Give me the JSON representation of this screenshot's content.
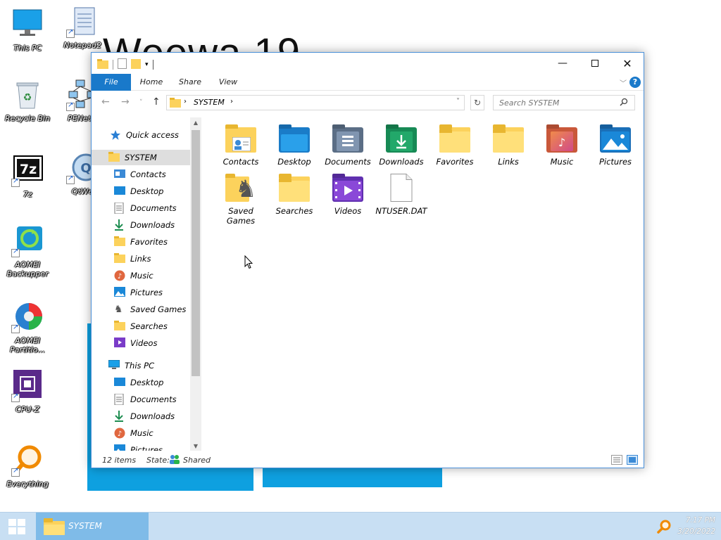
{
  "desktop": {
    "wallpaper_text": "Weewa 19",
    "icons": [
      {
        "label": "This PC"
      },
      {
        "label": "Notepad2"
      },
      {
        "label": "Recycle Bin"
      },
      {
        "label": "PENetw"
      },
      {
        "label": "7z"
      },
      {
        "label": "QtWe"
      },
      {
        "label": "AOMEI Backupper"
      },
      {
        "label": "AOMEI Partitio..."
      },
      {
        "label": "CPU-Z"
      },
      {
        "label": "Everything"
      }
    ]
  },
  "window": {
    "ribbon_tabs": {
      "file": "File",
      "home": "Home",
      "share": "Share",
      "view": "View"
    },
    "help_label": "?",
    "address": {
      "crumb": "SYSTEM"
    },
    "search": {
      "placeholder": "Search SYSTEM"
    },
    "nav": {
      "quick_access": "Quick access",
      "system": "SYSTEM",
      "system_children": [
        "Contacts",
        "Desktop",
        "Documents",
        "Downloads",
        "Favorites",
        "Links",
        "Music",
        "Pictures",
        "Saved Games",
        "Searches",
        "Videos"
      ],
      "this_pc": "This PC",
      "this_pc_children": [
        "Desktop",
        "Documents",
        "Downloads",
        "Music",
        "Pictures"
      ]
    },
    "items": [
      {
        "label": "Contacts"
      },
      {
        "label": "Desktop"
      },
      {
        "label": "Documents"
      },
      {
        "label": "Downloads"
      },
      {
        "label": "Favorites"
      },
      {
        "label": "Links"
      },
      {
        "label": "Music"
      },
      {
        "label": "Pictures"
      },
      {
        "label": "Saved Games"
      },
      {
        "label": "Searches"
      },
      {
        "label": "Videos"
      },
      {
        "label": "NTUSER.DAT"
      }
    ],
    "status": {
      "count": "12 items",
      "state_label": "State:",
      "state_value": "Shared"
    }
  },
  "taskbar": {
    "task_label": "SYSTEM",
    "time": "7:17 PM",
    "date": "3/20/2022"
  },
  "colors": {
    "accent": "#1979ca",
    "folder": "#fcd25c",
    "taskbar": "#c8dff3"
  }
}
